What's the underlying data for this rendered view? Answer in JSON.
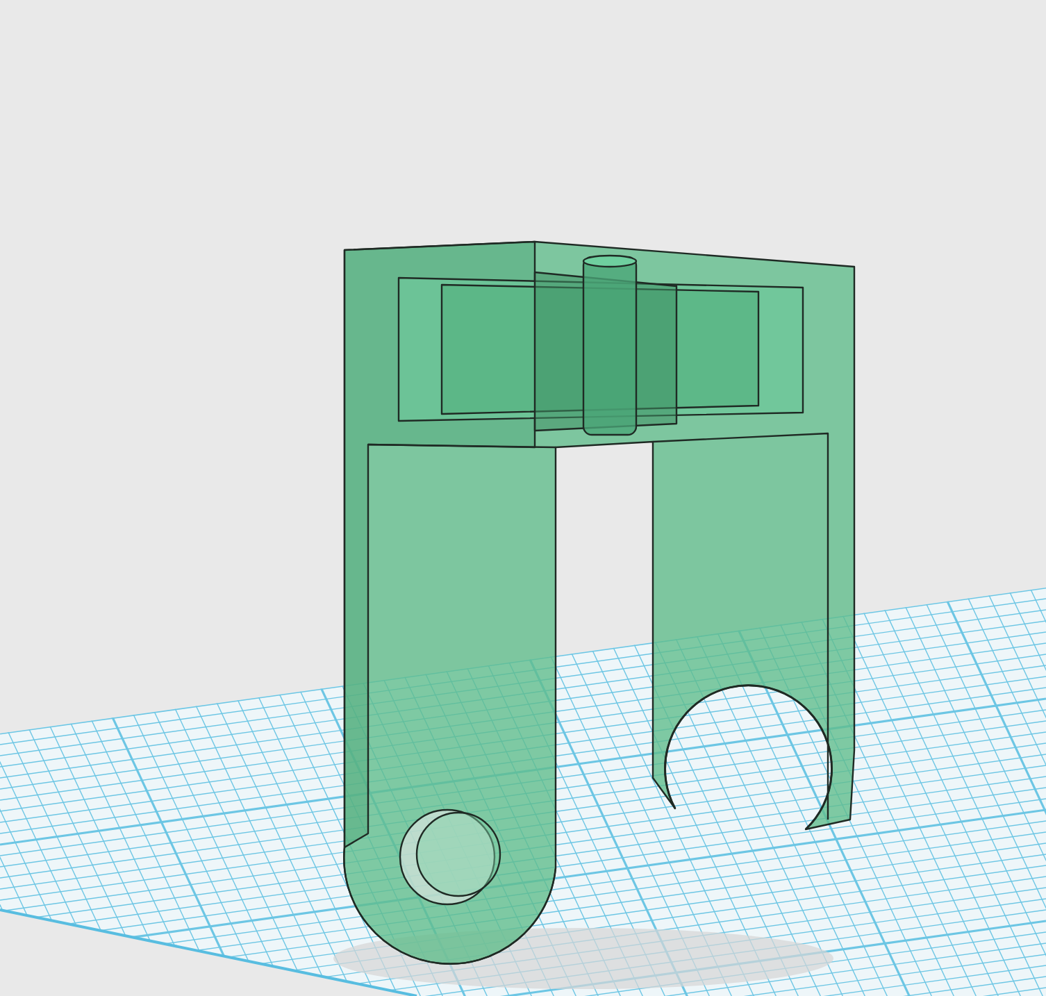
{
  "viewport": {
    "grid_visible": true,
    "model": {
      "transparent": true
    }
  }
}
